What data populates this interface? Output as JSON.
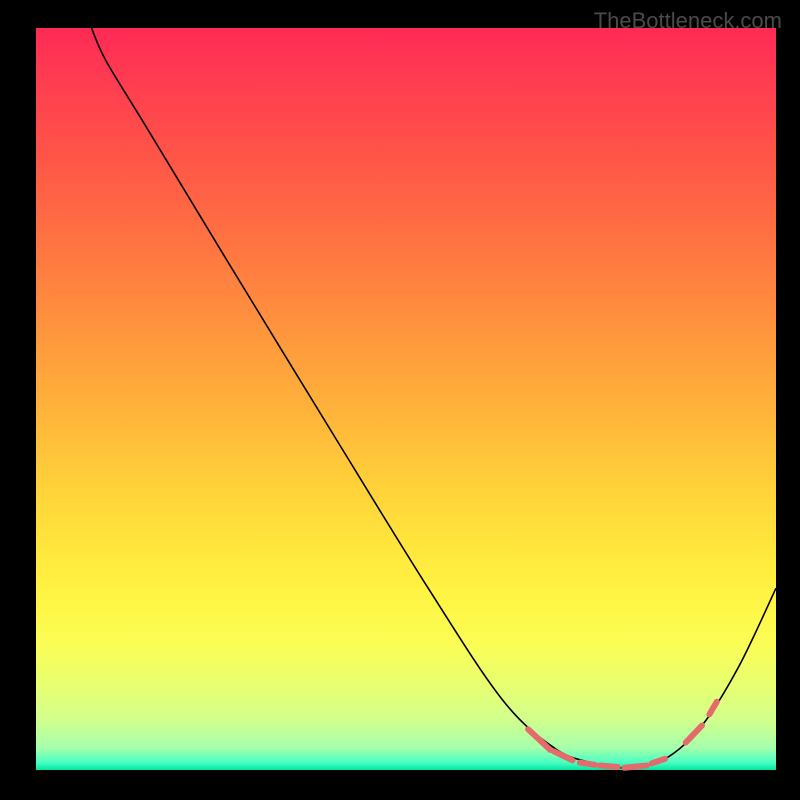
{
  "watermark": "TheBottleneck.com",
  "chart_data": {
    "type": "line",
    "title": "",
    "xlabel": "",
    "ylabel": "",
    "xlim_norm": [
      0,
      1
    ],
    "ylim_norm": [
      0,
      1
    ],
    "note": "Axes are unlabeled; x/y given as normalized 0-1 within the plot area. y=0 is bottom. Single black bottleneck curve with pink dashed segments near the trough.",
    "series": [
      {
        "name": "bottleneck-curve",
        "x": [
          0.075,
          0.095,
          0.15,
          0.25,
          0.4,
          0.53,
          0.63,
          0.7,
          0.75,
          0.8,
          0.85,
          0.9,
          0.95,
          1.0
        ],
        "y": [
          1.0,
          0.955,
          0.865,
          0.7,
          0.455,
          0.245,
          0.095,
          0.03,
          0.01,
          0.003,
          0.015,
          0.06,
          0.14,
          0.245
        ]
      },
      {
        "name": "dashed-highlight-segments",
        "segments": [
          {
            "x0": 0.665,
            "y0": 0.055,
            "x1": 0.695,
            "y1": 0.027
          },
          {
            "x0": 0.7,
            "y0": 0.025,
            "x1": 0.725,
            "y1": 0.013
          },
          {
            "x0": 0.735,
            "y0": 0.01,
            "x1": 0.755,
            "y1": 0.007
          },
          {
            "x0": 0.762,
            "y0": 0.006,
            "x1": 0.786,
            "y1": 0.004
          },
          {
            "x0": 0.795,
            "y0": 0.003,
            "x1": 0.825,
            "y1": 0.006
          },
          {
            "x0": 0.832,
            "y0": 0.009,
            "x1": 0.85,
            "y1": 0.015
          },
          {
            "x0": 0.878,
            "y0": 0.037,
            "x1": 0.9,
            "y1": 0.06
          },
          {
            "x0": 0.91,
            "y0": 0.075,
            "x1": 0.92,
            "y1": 0.092
          }
        ]
      }
    ]
  }
}
